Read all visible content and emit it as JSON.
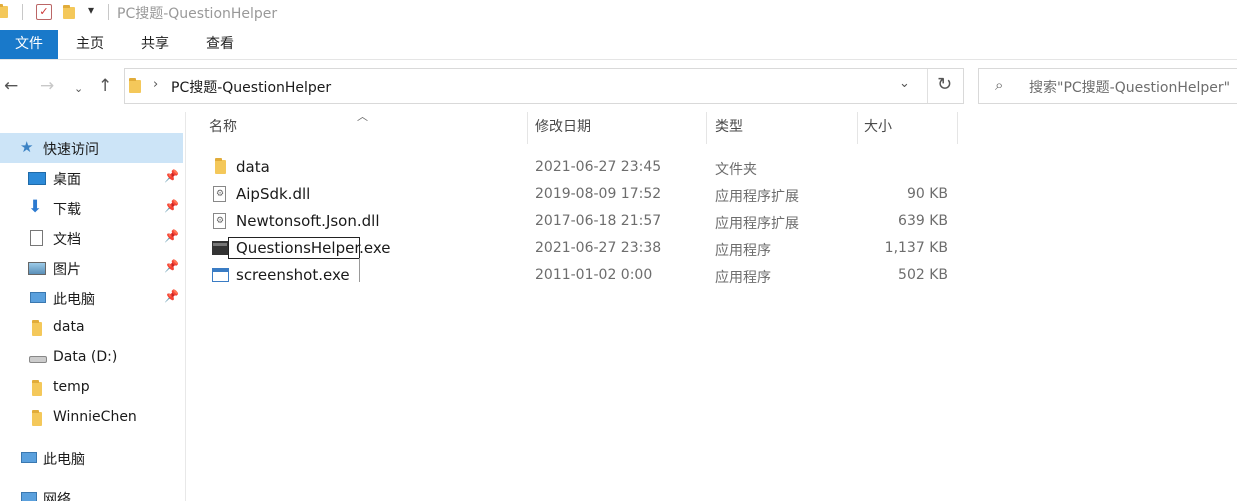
{
  "title_bar": {
    "title": "PC搜题-QuestionHelper",
    "icons": [
      "folder-icon",
      "properties-icon",
      "new-folder-icon",
      "customize-dropdown-icon"
    ]
  },
  "ribbon": {
    "tabs": [
      "文件",
      "主页",
      "共享",
      "查看"
    ]
  },
  "address_bar": {
    "path": "PC搜题-QuestionHelper",
    "back_icon": "back-arrow-icon",
    "forward_icon": "forward-arrow-icon",
    "recent_icon": "chevron-down-icon",
    "up_icon": "up-arrow-icon",
    "refresh_icon": "refresh-icon"
  },
  "search": {
    "placeholder": "搜索\"PC搜题-QuestionHelper\""
  },
  "nav_pane": {
    "items": [
      {
        "label": "快速访问",
        "icon": "star-icon",
        "selected": true,
        "pinned": false
      },
      {
        "label": "桌面",
        "icon": "desktop-icon",
        "pinned": true
      },
      {
        "label": "下载",
        "icon": "download-icon",
        "pinned": true
      },
      {
        "label": "文档",
        "icon": "document-icon",
        "pinned": true
      },
      {
        "label": "图片",
        "icon": "pictures-icon",
        "pinned": true
      },
      {
        "label": "此电脑",
        "icon": "computer-icon",
        "pinned": true
      },
      {
        "label": "data",
        "icon": "folder-icon",
        "pinned": false
      },
      {
        "label": "Data (D:)",
        "icon": "drive-icon",
        "pinned": false
      },
      {
        "label": "temp",
        "icon": "folder-icon",
        "pinned": false
      },
      {
        "label": "WinnieChen",
        "icon": "folder-icon",
        "pinned": false
      },
      {
        "label": "此电脑",
        "icon": "computer-icon",
        "pinned": false
      },
      {
        "label": "网络",
        "icon": "network-icon",
        "pinned": false
      }
    ]
  },
  "columns": {
    "name": "名称",
    "modified": "修改日期",
    "type": "类型",
    "size": "大小"
  },
  "files": [
    {
      "name": "data",
      "modified": "2021-06-27 23:45",
      "type": "文件夹",
      "size": "",
      "icon": "folder-icon"
    },
    {
      "name": "AipSdk.dll",
      "modified": "2019-08-09 17:52",
      "type": "应用程序扩展",
      "size": "90 KB",
      "icon": "dll-icon"
    },
    {
      "name": "Newtonsoft.Json.dll",
      "modified": "2017-06-18 21:57",
      "type": "应用程序扩展",
      "size": "639 KB",
      "icon": "dll-icon"
    },
    {
      "name": "QuestionsHelper.exe",
      "modified": "2021-06-27 23:38",
      "type": "应用程序",
      "size": "1,137 KB",
      "icon": "exe-icon"
    },
    {
      "name": "screenshot.exe",
      "modified": "2011-01-02 0:00",
      "type": "应用程序",
      "size": "502 KB",
      "icon": "window-exe-icon"
    }
  ],
  "colors": {
    "file_tab": "#1979ca",
    "selected_nav": "#cce4f7",
    "folder": "#f4c85a"
  }
}
